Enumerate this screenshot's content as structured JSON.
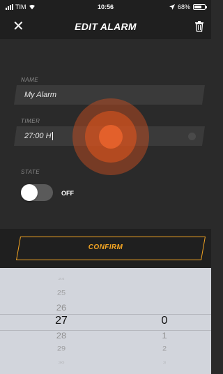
{
  "status": {
    "carrier": "TIM",
    "time": "10:56",
    "battery": "68%",
    "battery_level": 0.68
  },
  "header": {
    "title": "EDIT ALARM",
    "close_icon": "close-icon",
    "delete_icon": "trash-icon"
  },
  "form": {
    "name_label": "NAME",
    "name_value": "My Alarm",
    "timer_label": "TIMER",
    "timer_value": "27:00 H",
    "state_label": "STATE",
    "state_value": "OFF"
  },
  "confirm_label": "CONFIRM",
  "picker": {
    "hours": [
      "24",
      "25",
      "26",
      "27",
      "28",
      "29",
      "30"
    ],
    "minutes": [
      "0",
      "1",
      "2",
      "3"
    ],
    "selected_hour": "27",
    "selected_minute": "0"
  },
  "colors": {
    "accent": "#f5a623",
    "background": "#2a2a2a",
    "bar": "#1f1f1f",
    "picker_bg": "#d2d5dc"
  }
}
